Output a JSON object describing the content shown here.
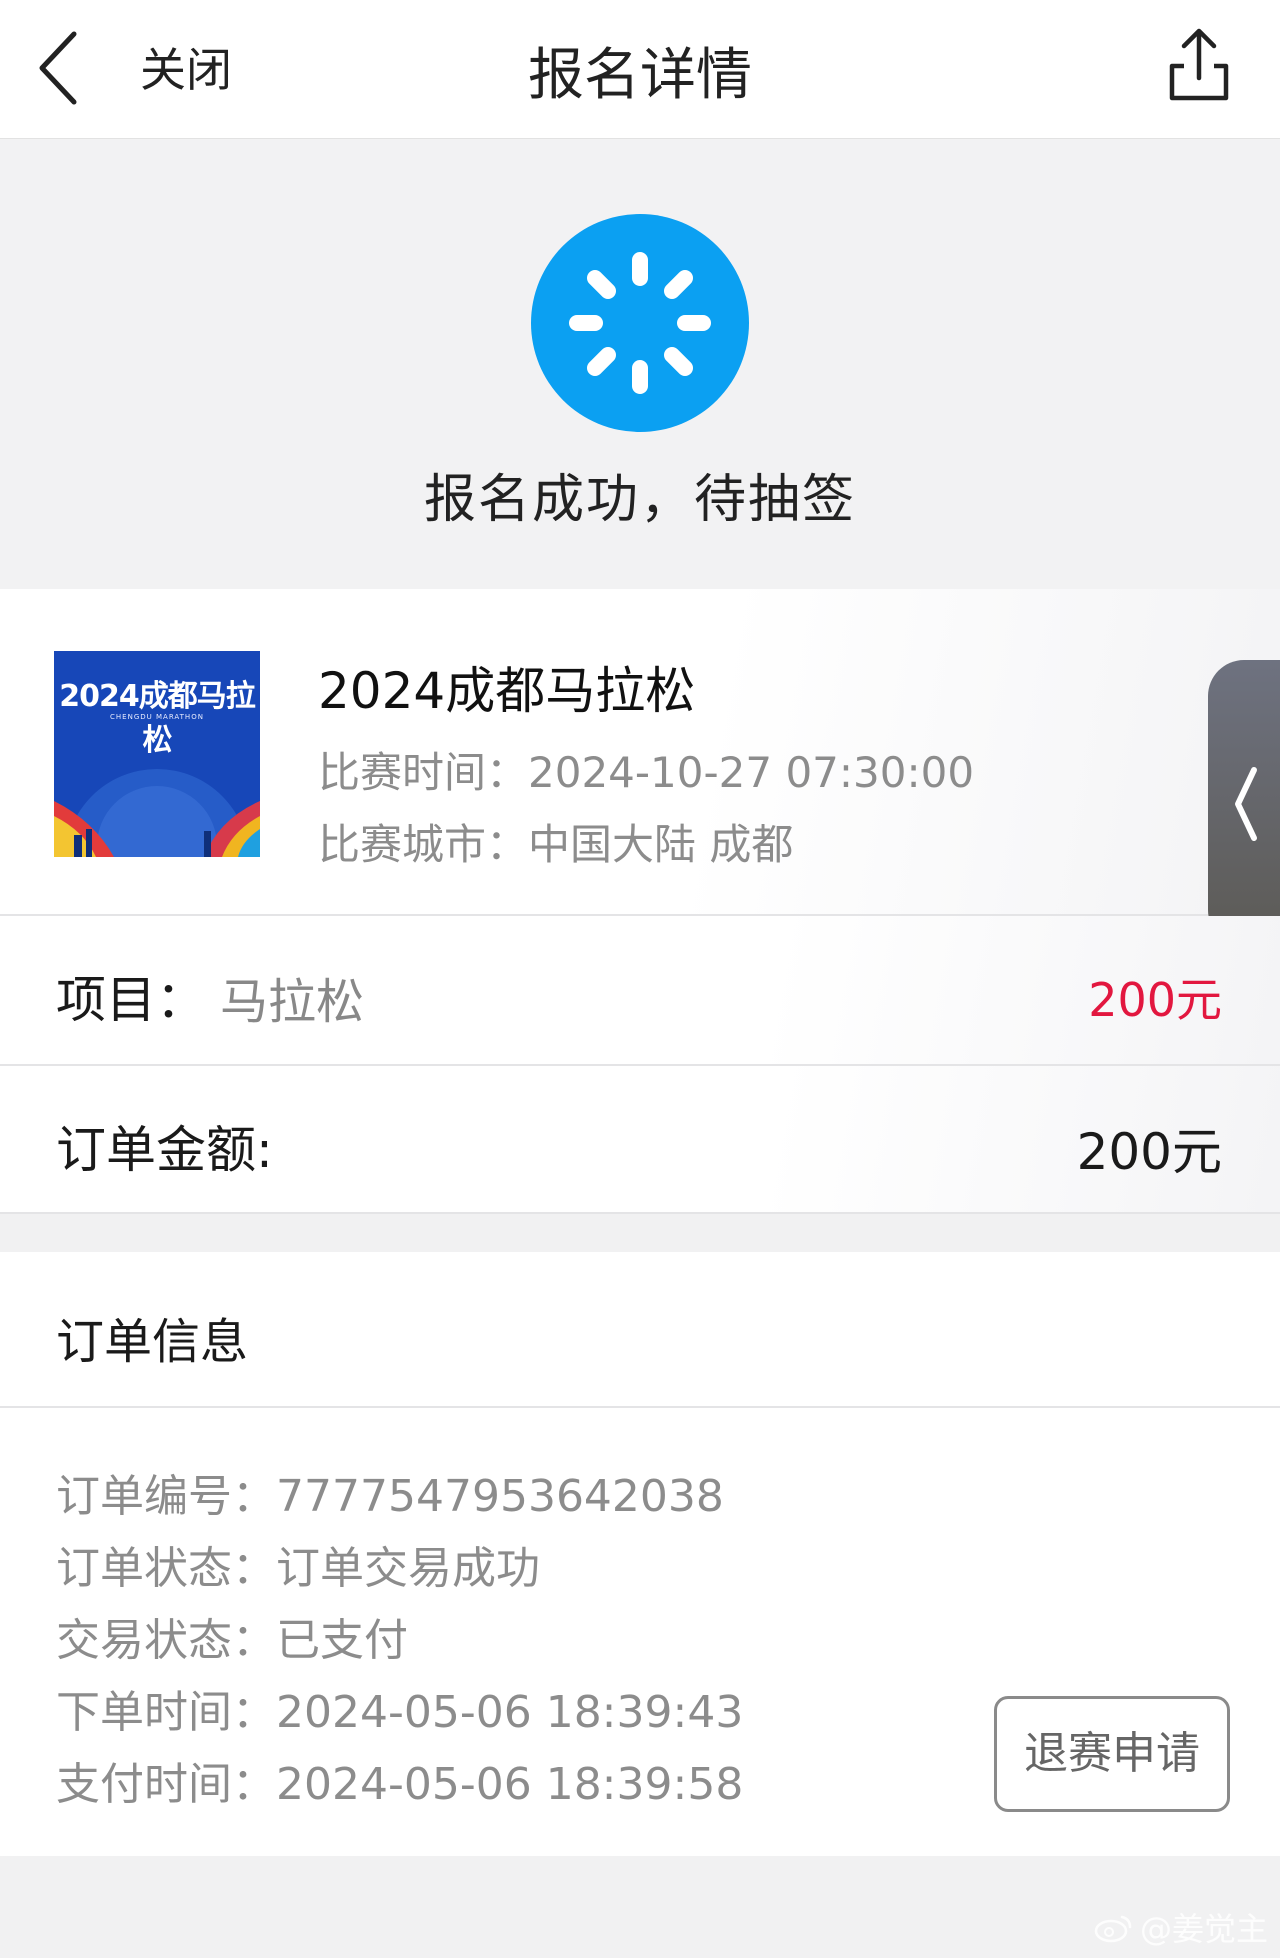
{
  "navbar": {
    "close_label": "关闭",
    "title": "报名详情",
    "back_icon": "chevron-left-icon",
    "share_icon": "share-icon"
  },
  "status": {
    "icon": "loading-spinner-icon",
    "icon_color": "#0ba0f2",
    "text": "报名成功，待抽签"
  },
  "event": {
    "banner_title": "2024成都马拉松",
    "banner_subtitle": "CHENGDU MARATHON",
    "name": "2024成都马拉松",
    "time_label": "比赛时间：",
    "time_value": "2024-10-27 07:30:00",
    "city_label": "比赛城市：",
    "city_value": "中国大陆 成都"
  },
  "items": {
    "project_label": "项目：",
    "project_value": "马拉松",
    "project_price": "200元",
    "project_price_color": "#e2173f",
    "amount_label": "订单金额:",
    "amount_value": "200元"
  },
  "order": {
    "title": "订单信息",
    "fields": [
      {
        "label": "订单编号：",
        "value": "7777547953642038"
      },
      {
        "label": "订单状态：",
        "value": "订单交易成功"
      },
      {
        "label": "交易状态：",
        "value": "已支付"
      },
      {
        "label": "下单时间：",
        "value": "2024-05-06 18:39:43"
      },
      {
        "label": "支付时间：",
        "value": "2024-05-06 18:39:58"
      }
    ],
    "refund_button": "退赛申请"
  },
  "watermark": {
    "icon": "weibo-icon",
    "text": "@姜觉主"
  }
}
